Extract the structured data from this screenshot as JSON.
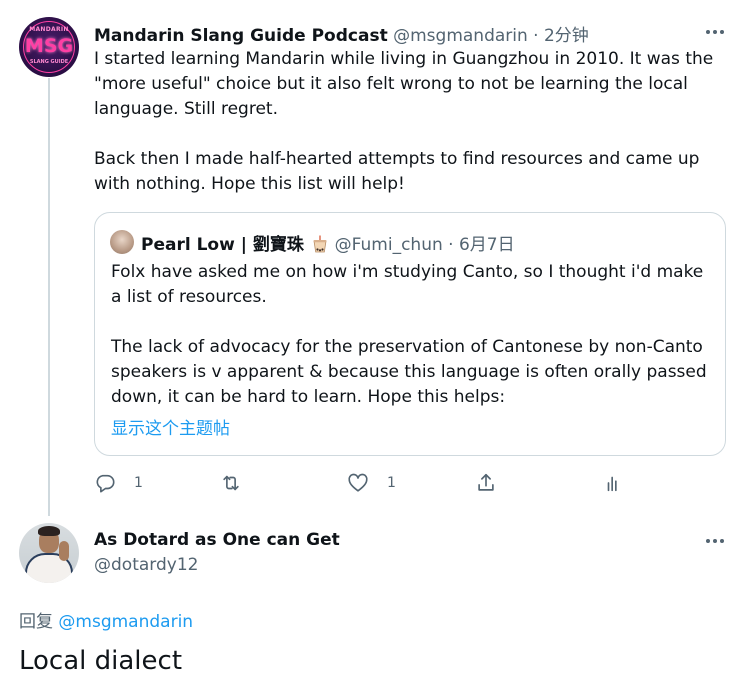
{
  "main_tweet": {
    "author_name": "Mandarin Slang Guide Podcast",
    "author_handle": "@msgmandarin",
    "separator": "·",
    "timestamp": "2分钟",
    "avatar": {
      "top_text": "MANDARIN",
      "center_text": "MSG",
      "bottom_text": "SLANG GUIDE"
    },
    "paragraphs": [
      "I started learning Mandarin while living in Guangzhou in 2010. It was the \"more useful\" choice but it also felt wrong to not be learning the local language. Still regret.",
      "Back then I made half-hearted attempts to find resources and came up with nothing. Hope this list will help!"
    ],
    "quoted_tweet": {
      "author_name": "Pearl Low | 劉寶珠",
      "emoji": "bubble-tea-emoji",
      "author_handle": "@Fumi_chun",
      "separator": "·",
      "timestamp": "6月7日",
      "paragraphs": [
        "Folx have asked me on how i'm studying Canto, so I thought i'd make a list of resources.",
        "The lack of advocacy for the preservation of Cantonese by non-Canto speakers is v apparent & because this language is often orally passed down, it can be hard to learn. Hope this helps:"
      ],
      "show_thread_link": "显示这个主题帖"
    },
    "actions": {
      "reply_count": "1",
      "retweet_count": "",
      "like_count": "1"
    }
  },
  "reply_tweet": {
    "author_name": "As Dotard as One can Get",
    "author_handle": "@dotardy12",
    "replying_to_label": "回复",
    "replying_to_handle": "@msgmandarin",
    "text": "Local dialect"
  },
  "colors": {
    "text_primary": "#0f1419",
    "text_secondary": "#536471",
    "link": "#1d9bf0",
    "border": "#cfd9de"
  }
}
